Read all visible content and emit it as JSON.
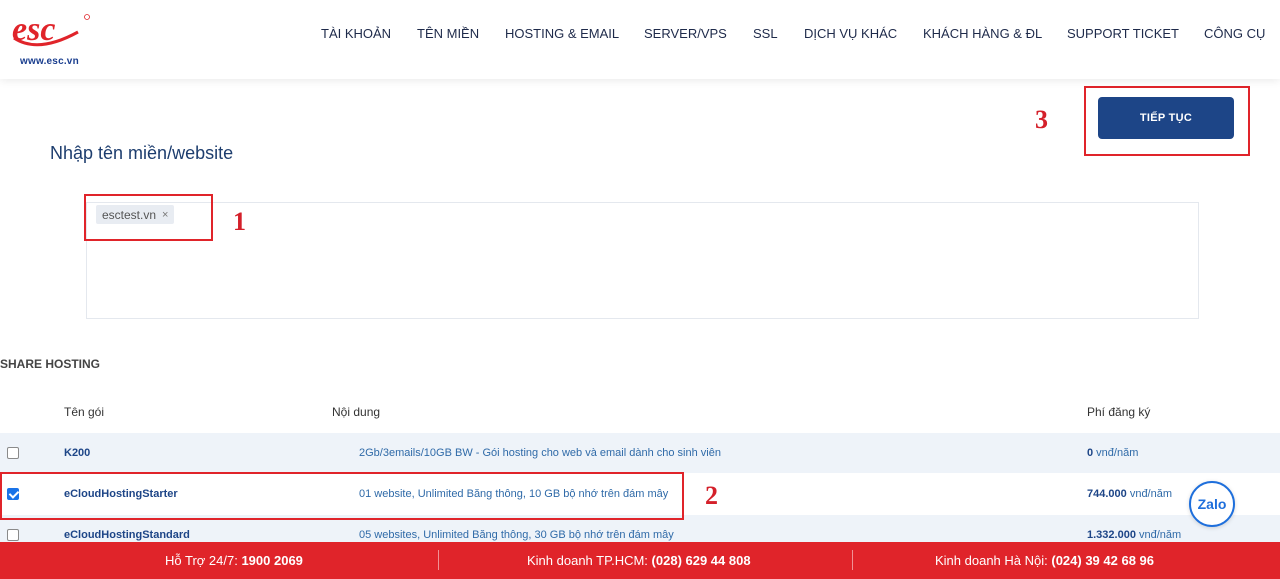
{
  "logo": {
    "text": "esc",
    "url": "www.esc.vn"
  },
  "nav": [
    {
      "label": "TÀI KHOẢN"
    },
    {
      "label": "TÊN MIỀN"
    },
    {
      "label": "HOSTING & EMAIL"
    },
    {
      "label": "SERVER/VPS"
    },
    {
      "label": "SSL"
    },
    {
      "label": "DỊCH VỤ KHÁC"
    },
    {
      "label": "KHÁCH HÀNG & ĐL"
    },
    {
      "label": "SUPPORT TICKET"
    },
    {
      "label": "CÔNG CỤ"
    }
  ],
  "continue_button": "TIẾP TỤC",
  "annotations": [
    "1",
    "2",
    "3"
  ],
  "domain_section": {
    "title": "Nhập tên miền/website",
    "tags": [
      {
        "value": "esctest.vn",
        "remove": "×"
      }
    ]
  },
  "share_hosting": {
    "title": "SHARE HOSTING",
    "columns": [
      "Tên gói",
      "Nội dung",
      "Phí đăng ký"
    ],
    "rows": [
      {
        "checked": false,
        "name": "K200",
        "content": "2Gb/3emails/10GB BW - Gói hosting cho web và email dành cho sinh viên",
        "price": "0",
        "unit": " vnđ/năm"
      },
      {
        "checked": true,
        "name": "eCloudHostingStarter",
        "content": "01 website, Unlimited Băng thông, 10 GB bộ nhớ trên đám mây",
        "price": "744.000",
        "unit": " vnđ/năm"
      },
      {
        "checked": false,
        "name": "eCloudHostingStandard",
        "content": "05 websites, Unlimited Băng thông, 30 GB bộ nhớ trên đám mây",
        "price": "1.332.000",
        "unit": " vnđ/năm"
      }
    ]
  },
  "zalo": "Zalo",
  "footer": {
    "support_label": "Hỗ Trợ 24/7: ",
    "support_phone": "1900 2069",
    "hcm_label": "Kinh doanh TP.HCM: ",
    "hcm_phone": "(028) 629 44 808",
    "hn_label": "Kinh doanh Hà Nội: ",
    "hn_phone": "(024) 39 42 68 96"
  },
  "colors": {
    "primary": "#1d4587",
    "accent_red": "#e0242a",
    "row_alt": "#eef3f9"
  }
}
